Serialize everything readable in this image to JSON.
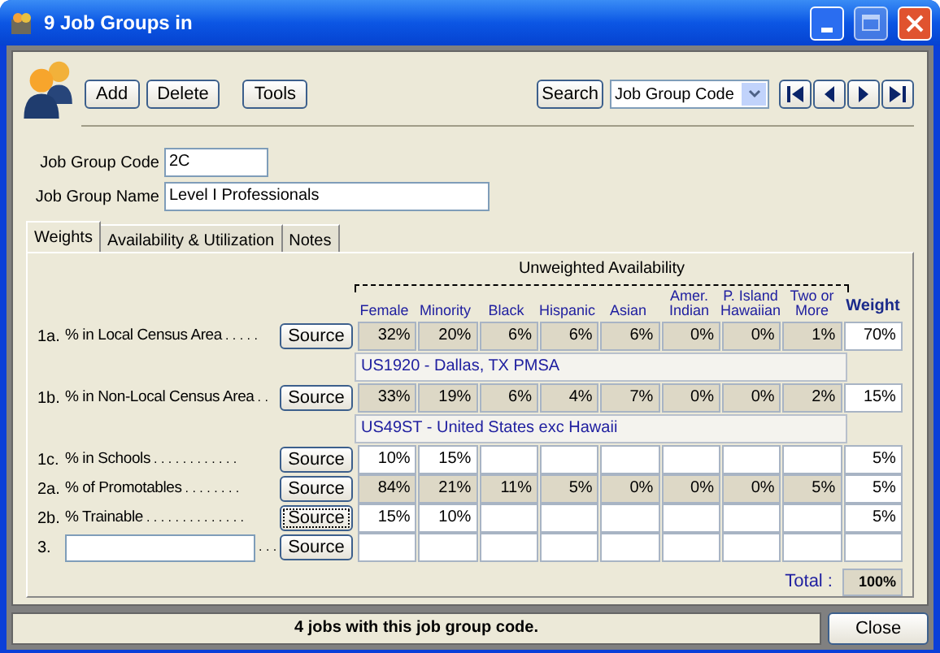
{
  "window": {
    "title": "9 Job Groups in"
  },
  "toolbar": {
    "buttons": [
      "Add",
      "Delete",
      "Tools"
    ],
    "search_button": "Search",
    "search_field": "Job Group Code"
  },
  "fields": [
    {
      "label": "Job Group Code",
      "value": "2C",
      "kind": "short"
    },
    {
      "label": "Job Group Name",
      "value": "Level I Professionals",
      "kind": "long"
    }
  ],
  "tabs": [
    {
      "label": "Weights",
      "selected": true
    },
    {
      "label": "Availability & Utilization",
      "selected": false
    },
    {
      "label": "Notes",
      "selected": false
    }
  ],
  "grid": {
    "group_title": "Unweighted Availability",
    "columns": [
      {
        "lines": [
          "Female"
        ]
      },
      {
        "lines": [
          "Minority"
        ]
      },
      {
        "lines": [
          "Black"
        ]
      },
      {
        "lines": [
          "Hispanic"
        ]
      },
      {
        "lines": [
          "Asian"
        ]
      },
      {
        "lines": [
          "Amer.",
          "Indian"
        ]
      },
      {
        "lines": [
          "P. Island",
          "Hawaiian"
        ]
      },
      {
        "lines": [
          "Two or",
          "More"
        ]
      }
    ],
    "weight_heading": "Weight",
    "rows": [
      {
        "kind": "factor",
        "number": "1a.",
        "label": "% in Local Census Area",
        "dots": ". . . . .",
        "source": "Source",
        "focused": false,
        "shaded": true,
        "cells": [
          "32%",
          "20%",
          "6%",
          "6%",
          "6%",
          "0%",
          "0%",
          "1%"
        ],
        "weight": "70%"
      },
      {
        "kind": "area",
        "text": "US1920 - Dallas, TX PMSA"
      },
      {
        "kind": "factor",
        "number": "1b.",
        "label": "% in Non-Local Census Area",
        "dots": ". .",
        "source": "Source",
        "focused": false,
        "shaded": true,
        "cells": [
          "33%",
          "19%",
          "6%",
          "4%",
          "7%",
          "0%",
          "0%",
          "2%"
        ],
        "weight": "15%"
      },
      {
        "kind": "area",
        "text": "US49ST - United States exc Hawaii"
      },
      {
        "kind": "factor",
        "number": "1c.",
        "label": "% in Schools",
        "dots": ". . . . . . . . . . . .",
        "source": "Source",
        "focused": false,
        "shaded": false,
        "cells": [
          "10%",
          "15%",
          "",
          "",
          "",
          "",
          "",
          ""
        ],
        "weight": "5%"
      },
      {
        "kind": "factor",
        "number": "2a.",
        "label": "% of Promotables",
        "dots": ". . . . . . . .",
        "source": "Source",
        "focused": false,
        "shaded": true,
        "cells": [
          "84%",
          "21%",
          "11%",
          "5%",
          "0%",
          "0%",
          "0%",
          "5%"
        ],
        "weight": "5%"
      },
      {
        "kind": "factor",
        "number": "2b.",
        "label": "% Trainable",
        "dots": ". . . . . . . . . . . . . .",
        "source": "Source",
        "focused": true,
        "shaded": false,
        "cells": [
          "15%",
          "10%",
          "",
          "",
          "",
          "",
          "",
          ""
        ],
        "weight": "5%"
      },
      {
        "kind": "custom",
        "number": "3.",
        "dots": ". . .",
        "source": "Source",
        "focused": false,
        "shaded": false,
        "cells": [
          "",
          "",
          "",
          "",
          "",
          "",
          "",
          ""
        ],
        "weight": ""
      }
    ],
    "total_label": "Total :",
    "total": "100%"
  },
  "status_bar": {
    "message": "4 jobs with this job group code.",
    "close": "Close"
  }
}
